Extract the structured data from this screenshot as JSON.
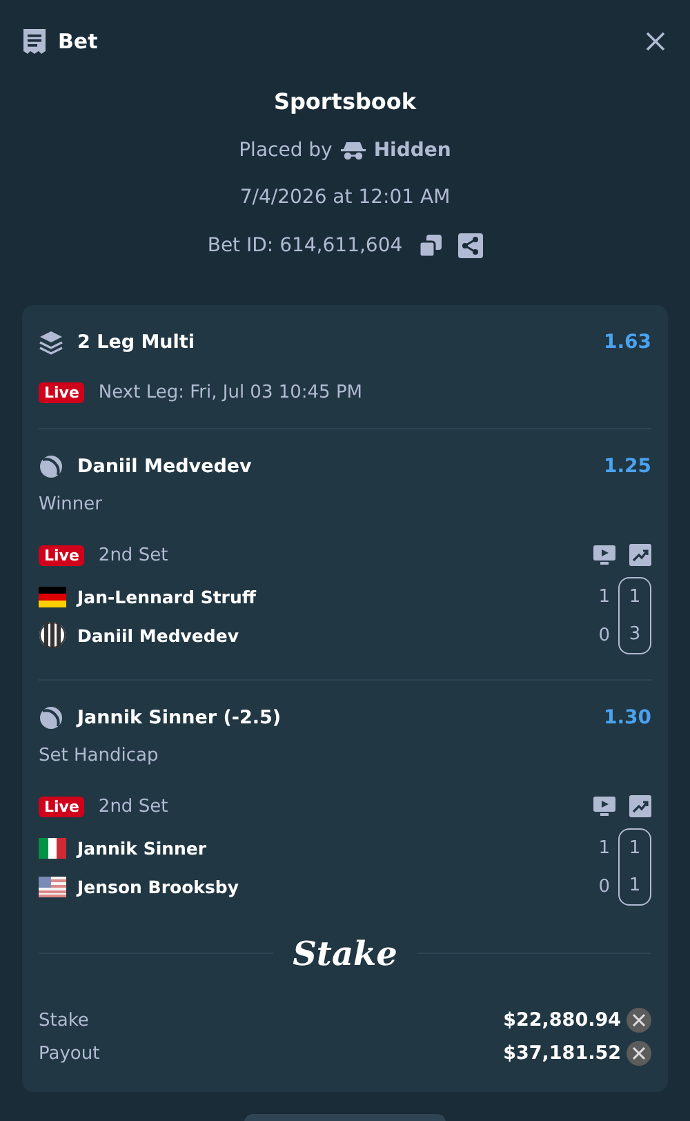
{
  "header": {
    "title": "Bet"
  },
  "summary": {
    "title": "Sportsbook",
    "placed_by_label": "Placed by",
    "placed_by_user": "Hidden",
    "datetime": "7/4/2026 at 12:01 AM",
    "bet_id": "Bet ID: 614,611,604"
  },
  "multi": {
    "title": "2 Leg Multi",
    "odds": "1.63",
    "live_badge": "Live",
    "next_leg": "Next Leg: Fri, Jul 03 10:45 PM"
  },
  "legs": [
    {
      "selection": "Daniil Medvedev",
      "odds": "1.25",
      "market": "Winner",
      "live_badge": "Live",
      "period": "2nd Set",
      "players": [
        {
          "kind": "germany",
          "name": "Jan-Lennard Struff",
          "score_1": "1",
          "score_2": "1"
        },
        {
          "kind": "neutral",
          "name": "Daniil Medvedev",
          "score_1": "0",
          "score_2": "3"
        }
      ]
    },
    {
      "selection": "Jannik Sinner (-2.5)",
      "odds": "1.30",
      "market": "Set Handicap",
      "live_badge": "Live",
      "period": "2nd Set",
      "players": [
        {
          "kind": "italy",
          "name": "Jannik Sinner",
          "score_1": "1",
          "score_2": "1"
        },
        {
          "kind": "usa",
          "name": "Jenson Brooksby",
          "score_1": "0",
          "score_2": "1"
        }
      ]
    }
  ],
  "logo": "Stake",
  "totals": [
    {
      "label": "Stake",
      "value": "$22,880.94"
    },
    {
      "label": "Payout",
      "value": "$37,181.52"
    }
  ]
}
